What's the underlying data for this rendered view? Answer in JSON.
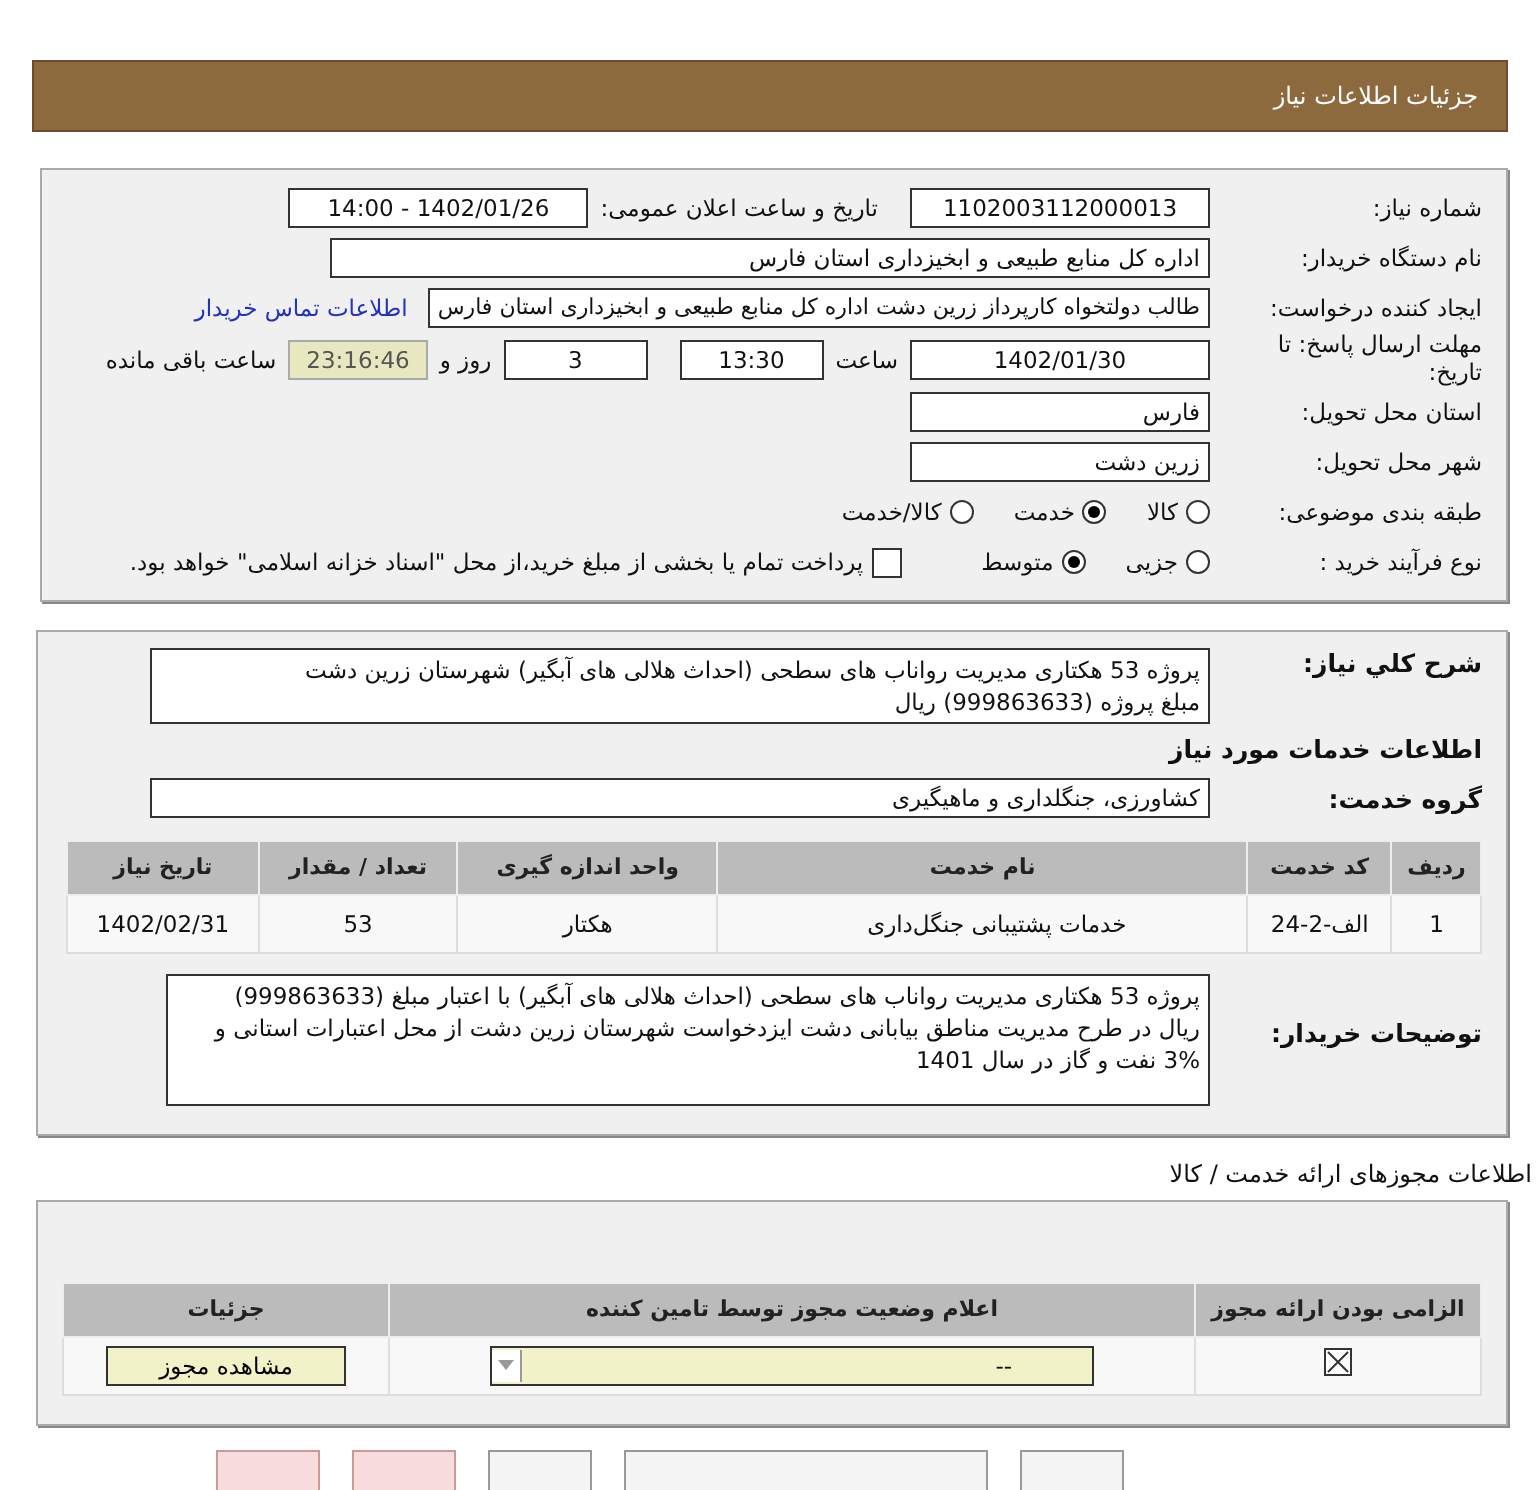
{
  "header": {
    "title": "جزئیات اطلاعات نیاز"
  },
  "info": {
    "need_number": {
      "label": "شماره نیاز:",
      "value": "1102003112000013"
    },
    "announce": {
      "label": "تاریخ و ساعت اعلان عمومی:",
      "value": "1402/01/26 - 14:00"
    },
    "buyer": {
      "label": "نام دستگاه خریدار:",
      "value": "اداره کل منابع طبیعی و ابخیزداری استان فارس"
    },
    "creator": {
      "label": "ایجاد کننده درخواست:",
      "value": "طالب دولتخواه کارپرداز زرین دشت اداره کل منابع طبیعی و ابخیزداری استان فارس",
      "link": "اطلاعات تماس خریدار"
    },
    "deadline": {
      "label": "مهلت ارسال پاسخ: تا تاریخ:",
      "date": "1402/01/30",
      "time_label": "ساعت",
      "time": "13:30",
      "days": "3",
      "days_label": "روز و",
      "remaining": "23:16:46",
      "remaining_label": "ساعت باقی مانده"
    },
    "province": {
      "label": "استان محل تحویل:",
      "value": "فارس"
    },
    "city": {
      "label": "شهر محل تحویل:",
      "value": "زرین دشت"
    },
    "category": {
      "label": "طبقه بندی موضوعی:",
      "options": [
        {
          "label": "کالا",
          "selected": false
        },
        {
          "label": "خدمت",
          "selected": true
        },
        {
          "label": "کالا/خدمت",
          "selected": false
        }
      ]
    },
    "process": {
      "label": "نوع فرآیند خرید :",
      "options": [
        {
          "label": "جزیی",
          "selected": false
        },
        {
          "label": "متوسط",
          "selected": true
        }
      ],
      "treasury": {
        "label": "پرداخت تمام یا بخشی از مبلغ خرید،از محل \"اسناد خزانه اسلامی\" خواهد بود.",
        "checked": false
      }
    }
  },
  "need": {
    "label": "شرح کلي نياز:",
    "lines": [
      "پروژه 53 هکتاری مدیریت رواناب های سطحی (احداث هلالی های آبگیر) شهرستان زرین دشت",
      "مبلغ پروژه (999863633) ریال"
    ]
  },
  "services": {
    "heading": "اطلاعات خدمات مورد نياز",
    "group_label": "گروه خدمت:",
    "group": "کشاورزی، جنگلداری و ماهیگیری",
    "columns": [
      "ردیف",
      "کد خدمت",
      "نام خدمت",
      "واحد اندازه گیری",
      "تعداد / مقدار",
      "تاریخ نیاز"
    ],
    "rows": [
      [
        "1",
        "الف-2-24",
        "خدمات پشتیبانی جنگل‌داری",
        "هکتار",
        "53",
        "1402/02/31"
      ]
    ]
  },
  "buyer_notes": {
    "label": "توضیحات خریدار:",
    "lines": [
      "پروژه 53 هکتاری مدیریت رواناب های سطحی (احداث هلالی های آبگیر)  با اعتبار مبلغ (999863633)",
      "ریال در طرح مدیریت مناطق بیابانی دشت ایزدخواست  شهرستان زرین دشت از محل اعتبارات استانی و",
      "3% نفت و گاز در سال 1401"
    ]
  },
  "permits": {
    "heading": "اطلاعات مجوزهای ارائه خدمت / کالا",
    "columns": [
      "الزامی بودن ارائه مجوز",
      "اعلام وضعیت مجوز توسط تامین کننده",
      "جزئیات"
    ],
    "rows": [
      {
        "required": true,
        "status": "--",
        "button": "مشاهده مجوز"
      }
    ]
  }
}
